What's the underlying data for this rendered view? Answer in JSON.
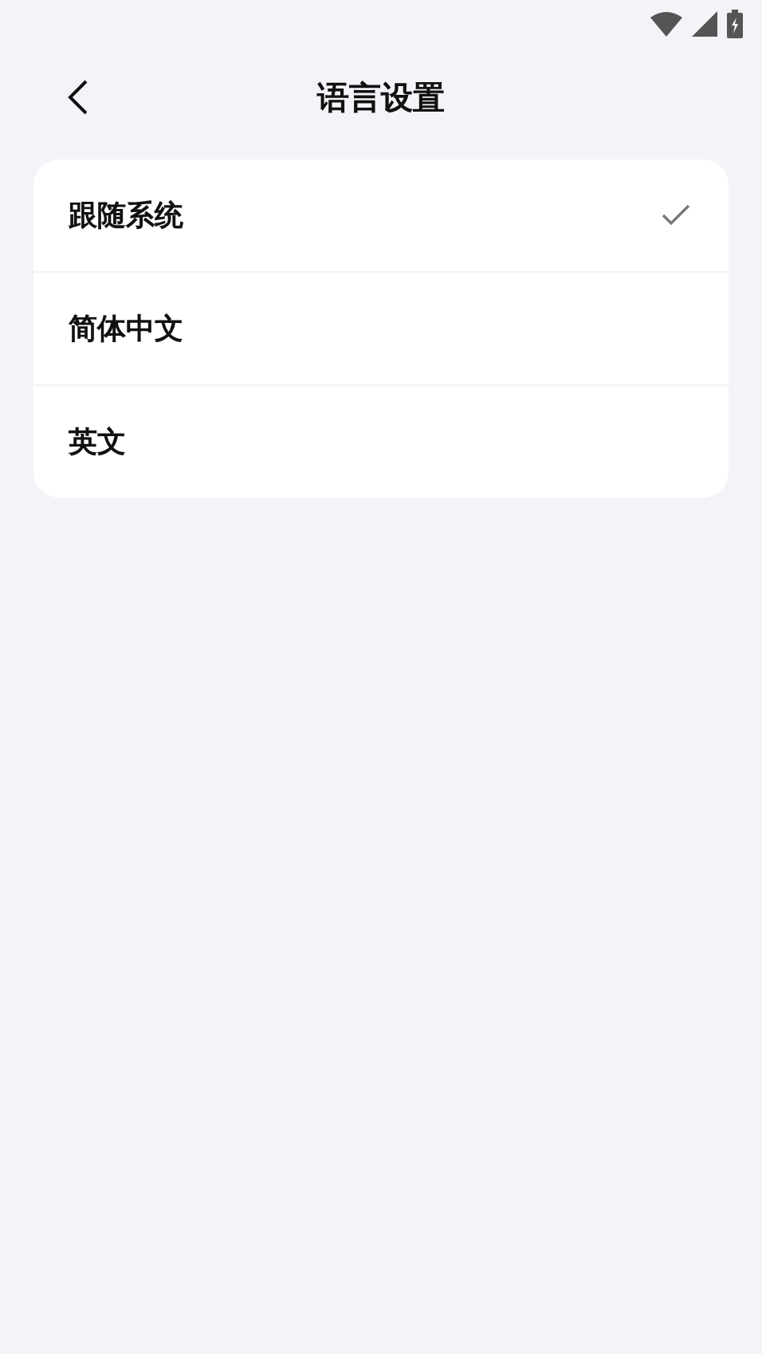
{
  "header": {
    "title": "语言设置"
  },
  "languages": [
    {
      "label": "跟随系统",
      "selected": true
    },
    {
      "label": "简体中文",
      "selected": false
    },
    {
      "label": "英文",
      "selected": false
    }
  ]
}
